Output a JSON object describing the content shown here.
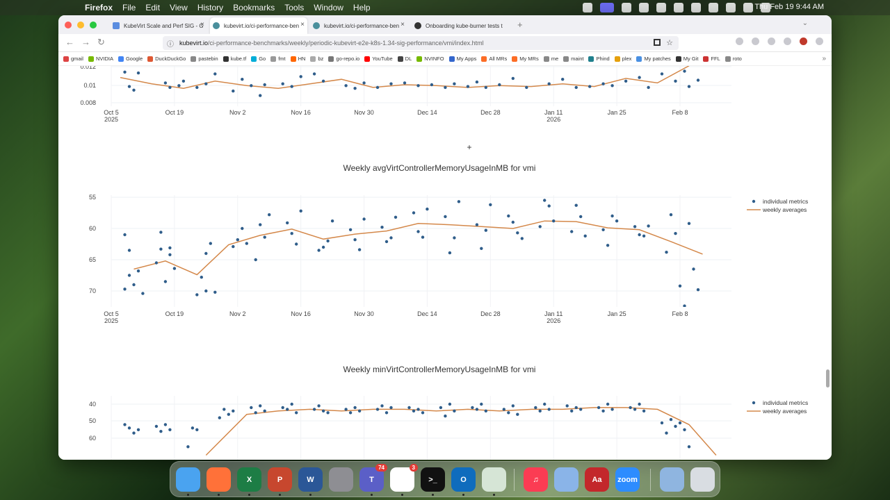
{
  "menubar": {
    "app": "Firefox",
    "items": [
      "File",
      "Edit",
      "View",
      "History",
      "Bookmarks",
      "Tools",
      "Window",
      "Help"
    ],
    "clock": "Thu Feb 19  9:44 AM"
  },
  "tabs": [
    {
      "title": "KubeVirt Scale and Perf SIG - G",
      "active": false
    },
    {
      "title": "kubevirt.io/ci-performance-ben",
      "active": true
    },
    {
      "title": "kubevirt.io/ci-performance-ben",
      "active": false
    },
    {
      "title": "Onboarding kube-burner tests t",
      "active": false
    }
  ],
  "url": {
    "host": "kubevirt.io",
    "path": "/ci-performance-benchmarks/weekly/periodic-kubevirt-e2e-k8s-1.34-sig-performance/vmi/index.html"
  },
  "bookmarks": [
    "gmail",
    "NVIDIA",
    "Google",
    "DuckDuckGo",
    "pastebin",
    "kube.tf",
    "Go",
    "fmt",
    "HN",
    "bz",
    "go-repo.io",
    "YouTube",
    "DL",
    "NVINFO",
    "My Apps",
    "All MRs",
    "My MRs",
    "me",
    "maint",
    "Phind",
    "plex",
    "My patches",
    "My Git",
    "FFL",
    "roto"
  ],
  "legend": {
    "individual": "individual metrics",
    "weekly": "weekly averages"
  },
  "colors": {
    "points": "#2f5d8a",
    "line": "#d4884a"
  },
  "xaxis": {
    "ticks": [
      "Oct 5",
      "Oct 19",
      "Nov 2",
      "Nov 16",
      "Nov 30",
      "Dec 14",
      "Dec 28",
      "Jan 11",
      "Jan 25",
      "Feb 8"
    ],
    "year_labels": {
      "Oct 5": "2025",
      "Jan 11": "2026"
    }
  },
  "chart_data": [
    {
      "type": "scatter",
      "title": "",
      "yticks": [
        "0.012",
        "0.01",
        "0.008"
      ],
      "ylim": [
        0.0076,
        0.0124
      ],
      "partial": true,
      "series": [
        {
          "name": "individual metrics",
          "x": [
            "2025-10-08",
            "2025-10-09",
            "2025-10-10",
            "2025-10-11",
            "2025-10-17",
            "2025-10-18",
            "2025-10-20",
            "2025-10-21",
            "2025-10-24",
            "2025-10-26",
            "2025-10-28",
            "2025-11-01",
            "2025-11-03",
            "2025-11-05",
            "2025-11-07",
            "2025-11-08",
            "2025-11-12",
            "2025-11-14",
            "2025-11-16",
            "2025-11-19",
            "2025-11-21",
            "2025-11-26",
            "2025-11-28",
            "2025-11-30",
            "2025-12-03",
            "2025-12-06",
            "2025-12-09",
            "2025-12-12",
            "2025-12-15",
            "2025-12-18",
            "2025-12-20",
            "2025-12-23",
            "2025-12-25",
            "2025-12-27",
            "2025-12-30",
            "2026-01-02",
            "2026-01-05",
            "2026-01-07",
            "2026-01-10",
            "2026-01-13",
            "2026-01-16",
            "2026-01-19",
            "2026-01-22",
            "2026-01-24",
            "2026-01-27",
            "2026-01-30",
            "2026-02-01",
            "2026-02-04",
            "2026-02-07",
            "2026-02-09",
            "2026-02-10",
            "2026-02-12"
          ],
          "values": [
            0.0114,
            0.0098,
            0.0094,
            0.0113,
            0.0102,
            0.0097,
            0.0099,
            0.0104,
            0.0097,
            0.0101,
            0.0112,
            0.0093,
            0.0106,
            0.0099,
            0.0088,
            0.01,
            0.0101,
            0.0098,
            0.0109,
            0.0112,
            0.0104,
            0.0099,
            0.0096,
            0.0102,
            0.0097,
            0.0101,
            0.0102,
            0.0099,
            0.01,
            0.0097,
            0.0101,
            0.0098,
            0.0103,
            0.0097,
            0.01,
            0.0107,
            0.0097,
            0.0123,
            0.0101,
            0.0106,
            0.0097,
            0.0098,
            0.0101,
            0.0099,
            0.0104,
            0.0108,
            0.0097,
            0.0112,
            0.0104,
            0.0115,
            0.0098,
            0.0105
          ]
        },
        {
          "name": "weekly averages",
          "x": [
            "2025-10-07",
            "2025-10-14",
            "2025-10-21",
            "2025-10-28",
            "2025-11-04",
            "2025-11-11",
            "2025-11-18",
            "2025-11-25",
            "2025-12-02",
            "2025-12-09",
            "2025-12-16",
            "2025-12-23",
            "2025-12-30",
            "2026-01-06",
            "2026-01-13",
            "2026-01-20",
            "2026-01-27",
            "2026-02-03",
            "2026-02-10"
          ],
          "values": [
            0.0108,
            0.0101,
            0.0096,
            0.0104,
            0.0099,
            0.0096,
            0.0101,
            0.0106,
            0.0097,
            0.01,
            0.0099,
            0.0097,
            0.0099,
            0.0098,
            0.0101,
            0.0098,
            0.0107,
            0.0102,
            0.0121
          ]
        }
      ]
    },
    {
      "type": "scatter",
      "title": "Weekly avgVirtControllerMemoryUsageInMB for vmi",
      "yticks": [
        "70",
        "65",
        "60",
        "55"
      ],
      "ylim": [
        52,
        71
      ],
      "series": [
        {
          "name": "individual metrics",
          "x": [
            "2025-10-08",
            "2025-10-08",
            "2025-10-09",
            "2025-10-09",
            "2025-10-10",
            "2025-10-11",
            "2025-10-12",
            "2025-10-15",
            "2025-10-16",
            "2025-10-16",
            "2025-10-17",
            "2025-10-18",
            "2025-10-18",
            "2025-10-19",
            "2025-10-24",
            "2025-10-25",
            "2025-10-26",
            "2025-10-26",
            "2025-10-27",
            "2025-10-28",
            "2025-11-01",
            "2025-11-02",
            "2025-11-03",
            "2025-11-04",
            "2025-11-06",
            "2025-11-07",
            "2025-11-08",
            "2025-11-09",
            "2025-11-13",
            "2025-11-14",
            "2025-11-15",
            "2025-11-16",
            "2025-11-20",
            "2025-11-21",
            "2025-11-22",
            "2025-11-23",
            "2025-11-27",
            "2025-11-28",
            "2025-11-29",
            "2025-11-30",
            "2025-12-04",
            "2025-12-05",
            "2025-12-06",
            "2025-12-07",
            "2025-12-11",
            "2025-12-12",
            "2025-12-13",
            "2025-12-14",
            "2025-12-18",
            "2025-12-19",
            "2025-12-20",
            "2025-12-21",
            "2025-12-25",
            "2025-12-26",
            "2025-12-27",
            "2025-12-28",
            "2026-01-01",
            "2026-01-02",
            "2026-01-03",
            "2026-01-04",
            "2026-01-08",
            "2026-01-09",
            "2026-01-10",
            "2026-01-11",
            "2026-01-15",
            "2026-01-16",
            "2026-01-17",
            "2026-01-18",
            "2026-01-22",
            "2026-01-23",
            "2026-01-24",
            "2026-01-25",
            "2026-01-29",
            "2026-01-30",
            "2026-01-31",
            "2026-02-01",
            "2026-02-05",
            "2026-02-06",
            "2026-02-07",
            "2026-02-08",
            "2026-02-09",
            "2026-02-10",
            "2026-02-11",
            "2026-02-12"
          ],
          "values": [
            64.0,
            55.3,
            57.5,
            61.5,
            56.0,
            58.2,
            54.6,
            59.5,
            61.7,
            64.4,
            56.5,
            61.9,
            60.8,
            58.6,
            54.4,
            57.2,
            55.0,
            61.0,
            62.6,
            54.8,
            62.1,
            63.2,
            65.0,
            62.6,
            60.0,
            65.6,
            63.6,
            67.2,
            65.9,
            64.2,
            62.5,
            67.8,
            61.5,
            62.0,
            63.0,
            66.2,
            64.8,
            63.2,
            61.6,
            66.5,
            65.2,
            62.9,
            63.5,
            66.8,
            67.5,
            64.5,
            63.6,
            68.1,
            66.9,
            61.1,
            63.5,
            69.3,
            65.6,
            61.8,
            64.7,
            68.8,
            67.0,
            66.0,
            64.3,
            63.4,
            65.3,
            69.5,
            68.6,
            66.2,
            64.5,
            68.7,
            66.9,
            63.8,
            64.8,
            62.3,
            67.0,
            66.2,
            65.3,
            64.0,
            63.8,
            65.4,
            61.2,
            67.2,
            64.2,
            55.8,
            52.6,
            65.8,
            58.5,
            55.2
          ]
        },
        {
          "name": "weekly averages",
          "x": [
            "2025-10-10",
            "2025-10-17",
            "2025-10-24",
            "2025-10-31",
            "2025-11-07",
            "2025-11-14",
            "2025-11-21",
            "2025-11-28",
            "2025-12-05",
            "2025-12-12",
            "2025-12-19",
            "2025-12-26",
            "2026-01-02",
            "2026-01-09",
            "2026-01-16",
            "2026-01-23",
            "2026-01-30",
            "2026-02-06",
            "2026-02-13"
          ],
          "values": [
            58.5,
            59.8,
            57.6,
            62.4,
            63.9,
            64.9,
            63.3,
            64.1,
            64.6,
            65.8,
            65.6,
            65.3,
            65.0,
            66.2,
            66.1,
            65.1,
            64.8,
            62.9,
            60.9
          ]
        }
      ]
    },
    {
      "type": "scatter",
      "title": "Weekly minVirtControllerMemoryUsageInMB for vmi",
      "yticks": [
        "60",
        "50",
        "40"
      ],
      "ylim": [
        30,
        64
      ],
      "partial": true,
      "series": [
        {
          "name": "individual metrics",
          "x": [
            "2025-10-08",
            "2025-10-09",
            "2025-10-10",
            "2025-10-11",
            "2025-10-15",
            "2025-10-16",
            "2025-10-17",
            "2025-10-18",
            "2025-10-22",
            "2025-10-23",
            "2025-10-24",
            "2025-10-29",
            "2025-10-30",
            "2025-10-31",
            "2025-11-01",
            "2025-11-05",
            "2025-11-06",
            "2025-11-07",
            "2025-11-08",
            "2025-11-12",
            "2025-11-13",
            "2025-11-14",
            "2025-11-15",
            "2025-11-19",
            "2025-11-20",
            "2025-11-21",
            "2025-11-22",
            "2025-11-26",
            "2025-11-27",
            "2025-11-28",
            "2025-11-29",
            "2025-12-03",
            "2025-12-04",
            "2025-12-05",
            "2025-12-06",
            "2025-12-10",
            "2025-12-11",
            "2025-12-12",
            "2025-12-13",
            "2025-12-17",
            "2025-12-18",
            "2025-12-19",
            "2025-12-20",
            "2025-12-24",
            "2025-12-25",
            "2025-12-26",
            "2025-12-27",
            "2025-12-31",
            "2026-01-01",
            "2026-01-02",
            "2026-01-03",
            "2026-01-07",
            "2026-01-08",
            "2026-01-09",
            "2026-01-10",
            "2026-01-14",
            "2026-01-15",
            "2026-01-16",
            "2026-01-17",
            "2026-01-21",
            "2026-01-22",
            "2026-01-23",
            "2026-01-24",
            "2026-01-28",
            "2026-01-29",
            "2026-01-30",
            "2026-01-31",
            "2026-02-04",
            "2026-02-05",
            "2026-02-06",
            "2026-02-07",
            "2026-02-08",
            "2026-02-09",
            "2026-02-10"
          ],
          "values": [
            48,
            46,
            43,
            45,
            47,
            44,
            48,
            45,
            35,
            46,
            45,
            52,
            57,
            54,
            56,
            58,
            55,
            59,
            56,
            58,
            57,
            60,
            55,
            57,
            59,
            56,
            55,
            57,
            55,
            58,
            56,
            57,
            59,
            55,
            58,
            58,
            56,
            57,
            55,
            58,
            53,
            60,
            56,
            58,
            57,
            60,
            56,
            57,
            55,
            59,
            54,
            58,
            56,
            60,
            57,
            59,
            56,
            58,
            57,
            58,
            56,
            60,
            57,
            58,
            57,
            60,
            56,
            49,
            43,
            51,
            47,
            49,
            45,
            35
          ]
        },
        {
          "name": "weekly averages",
          "x": [
            "2025-10-26",
            "2025-11-04",
            "2025-11-11",
            "2025-11-18",
            "2025-11-25",
            "2025-12-02",
            "2025-12-09",
            "2025-12-16",
            "2025-12-23",
            "2025-12-30",
            "2026-01-06",
            "2026-01-13",
            "2026-01-20",
            "2026-01-27",
            "2026-02-03",
            "2026-02-10",
            "2026-02-16"
          ],
          "values": [
            30,
            54,
            56,
            57,
            56,
            57,
            57,
            56,
            57,
            56,
            57,
            57,
            58,
            58,
            57,
            48,
            30
          ]
        }
      ]
    }
  ],
  "dock": [
    {
      "name": "Finder",
      "label": "",
      "badge": ""
    },
    {
      "name": "Firefox",
      "label": "",
      "badge": ""
    },
    {
      "name": "Excel",
      "label": "X",
      "badge": ""
    },
    {
      "name": "PowerPoint",
      "label": "P",
      "badge": ""
    },
    {
      "name": "Word",
      "label": "W",
      "badge": ""
    },
    {
      "name": "System Settings",
      "label": "",
      "badge": ""
    },
    {
      "name": "Teams",
      "label": "T",
      "badge": "74"
    },
    {
      "name": "Slack",
      "label": "",
      "badge": "3"
    },
    {
      "name": "Terminal",
      "label": ">_",
      "badge": ""
    },
    {
      "name": "Outlook",
      "label": "O",
      "badge": ""
    },
    {
      "name": "Maps",
      "label": "",
      "badge": ""
    },
    {
      "name": "Music",
      "label": "♫",
      "badge": ""
    },
    {
      "name": "Screen Sharing",
      "label": "",
      "badge": ""
    },
    {
      "name": "Dictionary",
      "label": "Aa",
      "badge": ""
    },
    {
      "name": "Zoom",
      "label": "zoom",
      "badge": ""
    },
    {
      "name": "Downloads",
      "label": "",
      "badge": ""
    },
    {
      "name": "Trash",
      "label": "",
      "badge": ""
    }
  ]
}
